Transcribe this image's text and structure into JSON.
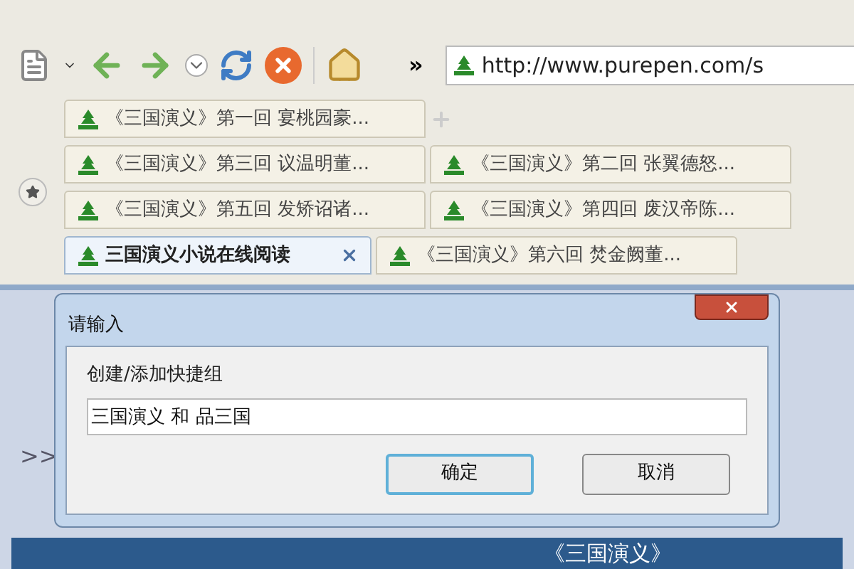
{
  "toolbar": {
    "overflow": "»",
    "address": "http://www.purepen.com/s"
  },
  "tab_rows": [
    [
      {
        "label": "《三国演义》第一回 宴桃园豪...",
        "selected": false
      }
    ],
    [
      {
        "label": "《三国演义》第三回 议温明董...",
        "selected": false
      },
      {
        "label": "《三国演义》第二回 张翼德怒...",
        "selected": false
      }
    ],
    [
      {
        "label": "《三国演义》第五回 发矫诏诸...",
        "selected": false
      },
      {
        "label": "《三国演义》第四回 废汉帝陈...",
        "selected": false
      }
    ],
    [
      {
        "label": "三国演义小说在线阅读",
        "selected": true
      },
      {
        "label": "《三国演义》第六回 焚金阙董...",
        "selected": false
      }
    ]
  ],
  "page": {
    "side_text": ">>",
    "banner": "《三国演义》"
  },
  "dialog": {
    "title": "请输入",
    "label": "创建/添加快捷组",
    "value": "三国演义 和 品三国",
    "buttons": [
      {
        "label": "确定",
        "kind": "default"
      },
      {
        "label": "取消",
        "kind": "normal"
      }
    ]
  }
}
